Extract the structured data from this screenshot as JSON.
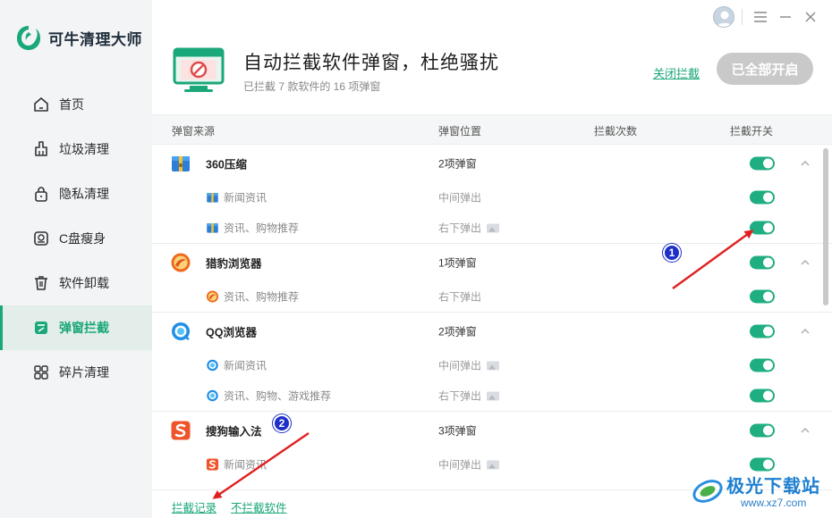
{
  "app": {
    "name": "可牛清理大师"
  },
  "sidebar": {
    "items": [
      {
        "label": "首页",
        "icon": "home-icon",
        "active": false
      },
      {
        "label": "垃圾清理",
        "icon": "broom-icon",
        "active": false
      },
      {
        "label": "隐私清理",
        "icon": "lock-icon",
        "active": false
      },
      {
        "label": "C盘瘦身",
        "icon": "disk-icon",
        "active": false
      },
      {
        "label": "软件卸载",
        "icon": "trash-icon",
        "active": false
      },
      {
        "label": "弹窗拦截",
        "icon": "popup-block-icon",
        "active": true
      },
      {
        "label": "碎片清理",
        "icon": "grid-icon",
        "active": false
      }
    ]
  },
  "header": {
    "title": "自动拦截软件弹窗，杜绝骚扰",
    "subtitle": "已拦截 7 款软件的 16 项弹窗",
    "close_link": "关闭拦截",
    "all_on_button": "已全部开启"
  },
  "table": {
    "columns": [
      "弹窗来源",
      "弹窗位置",
      "拦截次数",
      "拦截开关"
    ],
    "groups": [
      {
        "name": "360压缩",
        "icon": "archive-360-icon",
        "position": "2项弹窗",
        "enabled": true,
        "children": [
          {
            "name": "新闻资讯",
            "position": "中间弹出",
            "has_preview": false,
            "enabled": true
          },
          {
            "name": "资讯、购物推荐",
            "position": "右下弹出",
            "has_preview": true,
            "enabled": true
          }
        ]
      },
      {
        "name": "猎豹浏览器",
        "icon": "cheetah-browser-icon",
        "position": "1项弹窗",
        "enabled": true,
        "children": [
          {
            "name": "资讯、购物推荐",
            "position": "右下弹出",
            "has_preview": false,
            "enabled": true
          }
        ]
      },
      {
        "name": "QQ浏览器",
        "icon": "qq-browser-icon",
        "position": "2项弹窗",
        "enabled": true,
        "children": [
          {
            "name": "新闻资讯",
            "position": "中间弹出",
            "has_preview": true,
            "enabled": true
          },
          {
            "name": "资讯、购物、游戏推荐",
            "position": "右下弹出",
            "has_preview": true,
            "enabled": true
          }
        ]
      },
      {
        "name": "搜狗输入法",
        "icon": "sogou-input-icon",
        "position": "3项弹窗",
        "enabled": true,
        "children": [
          {
            "name": "新闻资讯",
            "position": "中间弹出",
            "has_preview": true,
            "enabled": true
          }
        ]
      }
    ]
  },
  "footer": {
    "records_link": "拦截记录",
    "not_blocked_link": "不拦截软件"
  },
  "annotations": {
    "badge1": "1",
    "badge2": "2",
    "arrow_color": "#e02020"
  },
  "watermark": {
    "text": "极光下载站",
    "url": "www.xz7.com"
  },
  "colors": {
    "accent": "#1aa77a",
    "toggle_on": "#1fae81",
    "sidebar_bg": "#f2f4f6",
    "disabled_button": "#c9c9c9"
  }
}
